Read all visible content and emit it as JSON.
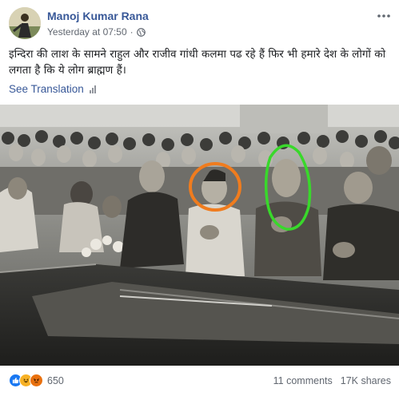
{
  "post": {
    "author": "Manoj Kumar Rana",
    "timestamp": "Yesterday at 07:50",
    "separator": "·",
    "text": "इन्दिरा की लाश के सामने राहुल और राजीव गांधी कलमा पढ रहे हैं फिर भी हमारे देश के लोगों को लगता है कि ये लोग ब्राह्मण हैं।",
    "see_translation_label": "See Translation",
    "privacy_icon": "globe-icon",
    "options_icon": "more-options-icon"
  },
  "reactions": {
    "types": [
      "like",
      "haha",
      "angry"
    ],
    "colors": {
      "like": "#1877f2",
      "haha": "#f7b125",
      "angry": "#e9710f"
    },
    "count": "650"
  },
  "stats": {
    "comments": "11 comments",
    "shares": "17K shares"
  },
  "photo": {
    "annotation_colors": {
      "orange_circle": "#f07c1e",
      "green_circle": "#39d82b"
    }
  }
}
